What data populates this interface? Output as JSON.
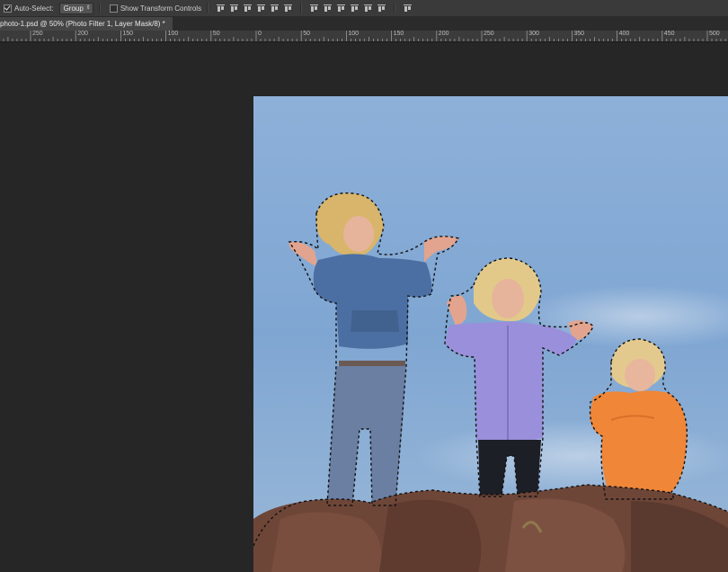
{
  "options_bar": {
    "auto_select_label": "Auto-Select:",
    "auto_select_value": "Group",
    "show_transform_label": "Show Transform Controls",
    "icons": [
      "align-top-edges-icon",
      "align-vertical-centers-icon",
      "align-bottom-edges-icon",
      "align-left-edges-icon",
      "align-horizontal-centers-icon",
      "align-right-edges-icon",
      "distribute-top-icon",
      "distribute-vertical-centers-icon",
      "distribute-bottom-icon",
      "distribute-left-icon",
      "distribute-horizontal-centers-icon",
      "distribute-right-icon",
      "auto-align-layers-icon"
    ]
  },
  "document": {
    "tab_title": "photo-1.psd @ 50% (Photo Filter 1, Layer Mask/8) *"
  },
  "ruler": {
    "labels": [
      "250",
      "200",
      "150",
      "100",
      "50",
      "0",
      "50",
      "100",
      "150",
      "200",
      "250",
      "300",
      "350",
      "400",
      "450",
      "500"
    ]
  },
  "colors": {
    "sky": "#7fa6d2",
    "rock": "#6e4638",
    "workspace": "#262626"
  }
}
